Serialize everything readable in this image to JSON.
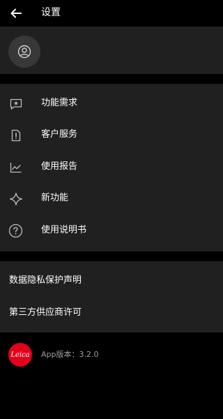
{
  "header": {
    "back_icon": "arrow-left-icon",
    "title": "设置"
  },
  "profile": {
    "avatar_icon": "user-circle-icon"
  },
  "menu": {
    "items": [
      {
        "label": "功能需求",
        "icon": "feedback-star-icon"
      },
      {
        "label": "客户服务",
        "icon": "document-exclamation-icon"
      },
      {
        "label": "使用报告",
        "icon": "line-chart-icon"
      },
      {
        "label": "新功能",
        "icon": "sparkle-icon"
      },
      {
        "label": "使用说明书",
        "icon": "help-circle-icon"
      }
    ]
  },
  "links": {
    "items": [
      {
        "label": "数据隐私保护声明"
      },
      {
        "label": "第三方供应商许可"
      }
    ]
  },
  "footer": {
    "logo_text": "Leica",
    "version": "App版本：3.2.0"
  },
  "colors": {
    "background": "#000000",
    "section": "#202020",
    "brand_red": "#e2001a",
    "muted_text": "#a0a0a0"
  }
}
